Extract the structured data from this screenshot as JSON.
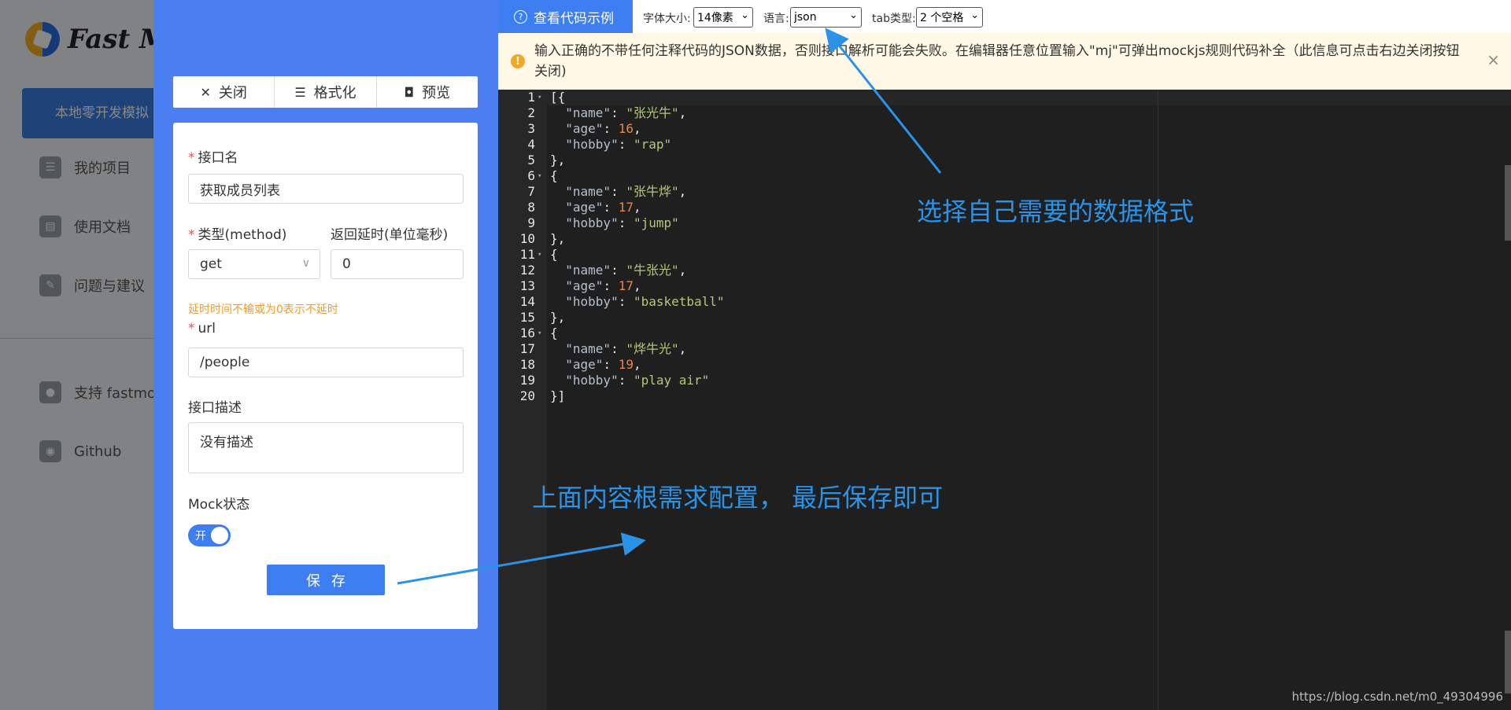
{
  "background": {
    "logo_text": "Fast M",
    "active_tab": "本地零开发模拟",
    "menu": [
      {
        "label": "我的项目",
        "icon": "list-icon"
      },
      {
        "label": "使用文档",
        "icon": "book-icon"
      },
      {
        "label": "问题与建议",
        "icon": "edit-icon"
      },
      {
        "label": "支持 fastmo",
        "icon": "drop-icon"
      },
      {
        "label": "Github",
        "icon": "github-icon"
      }
    ]
  },
  "drawer": {
    "toolbar": {
      "close_label": "关闭",
      "format_label": "格式化",
      "preview_label": "预览"
    },
    "form": {
      "name_label": "接口名",
      "name_value": "获取成员列表",
      "method_label": "类型(method)",
      "method_value": "get",
      "delay_label": "返回延时(单位毫秒)",
      "delay_value": "0",
      "delay_hint": "延时时间不输或为0表示不延时",
      "url_label": "url",
      "url_value": "/people",
      "desc_label": "接口描述",
      "desc_value": "没有描述",
      "mock_label": "Mock状态",
      "mock_toggle_text": "开",
      "mock_enabled": true,
      "save_label": "保存"
    }
  },
  "editor_toolbar": {
    "example_label": "查看代码示例",
    "font_size_label": "字体大小:",
    "font_size_value": "14像素",
    "language_label": "语言:",
    "language_value": "json",
    "tab_label": "tab类型:",
    "tab_value": "2 个空格"
  },
  "warning": {
    "text": "输入正确的不带任何注释代码的JSON数据，否则接口解析可能会失败。在编辑器任意位置输入\"mj\"可弹出mockjs规则代码补全（此信息可点击右边关闭按钮关闭)",
    "close_symbol": "×"
  },
  "code_lines": [
    "[{",
    "  \"name\": \"张光牛\",",
    "  \"age\": 16,",
    "  \"hobby\": \"rap\"",
    "},",
    "{",
    "  \"name\": \"张牛烨\",",
    "  \"age\": 17,",
    "  \"hobby\": \"jump\"",
    "},",
    "{",
    "  \"name\": \"牛张光\",",
    "  \"age\": 17,",
    "  \"hobby\": \"basketball\"",
    "},",
    "{",
    "  \"name\": \"烨牛光\",",
    "  \"age\": 19,",
    "  \"hobby\": \"play air\"",
    "}]"
  ],
  "fold_lines": [
    1,
    6,
    11,
    16
  ],
  "annotations": {
    "note_format": "选择自己需要的数据格式",
    "note_save": "上面内容根需求配置， 最后保存即可",
    "arrow_color": "#2a93e8"
  },
  "watermark": "https://blog.csdn.net/m0_49304996"
}
